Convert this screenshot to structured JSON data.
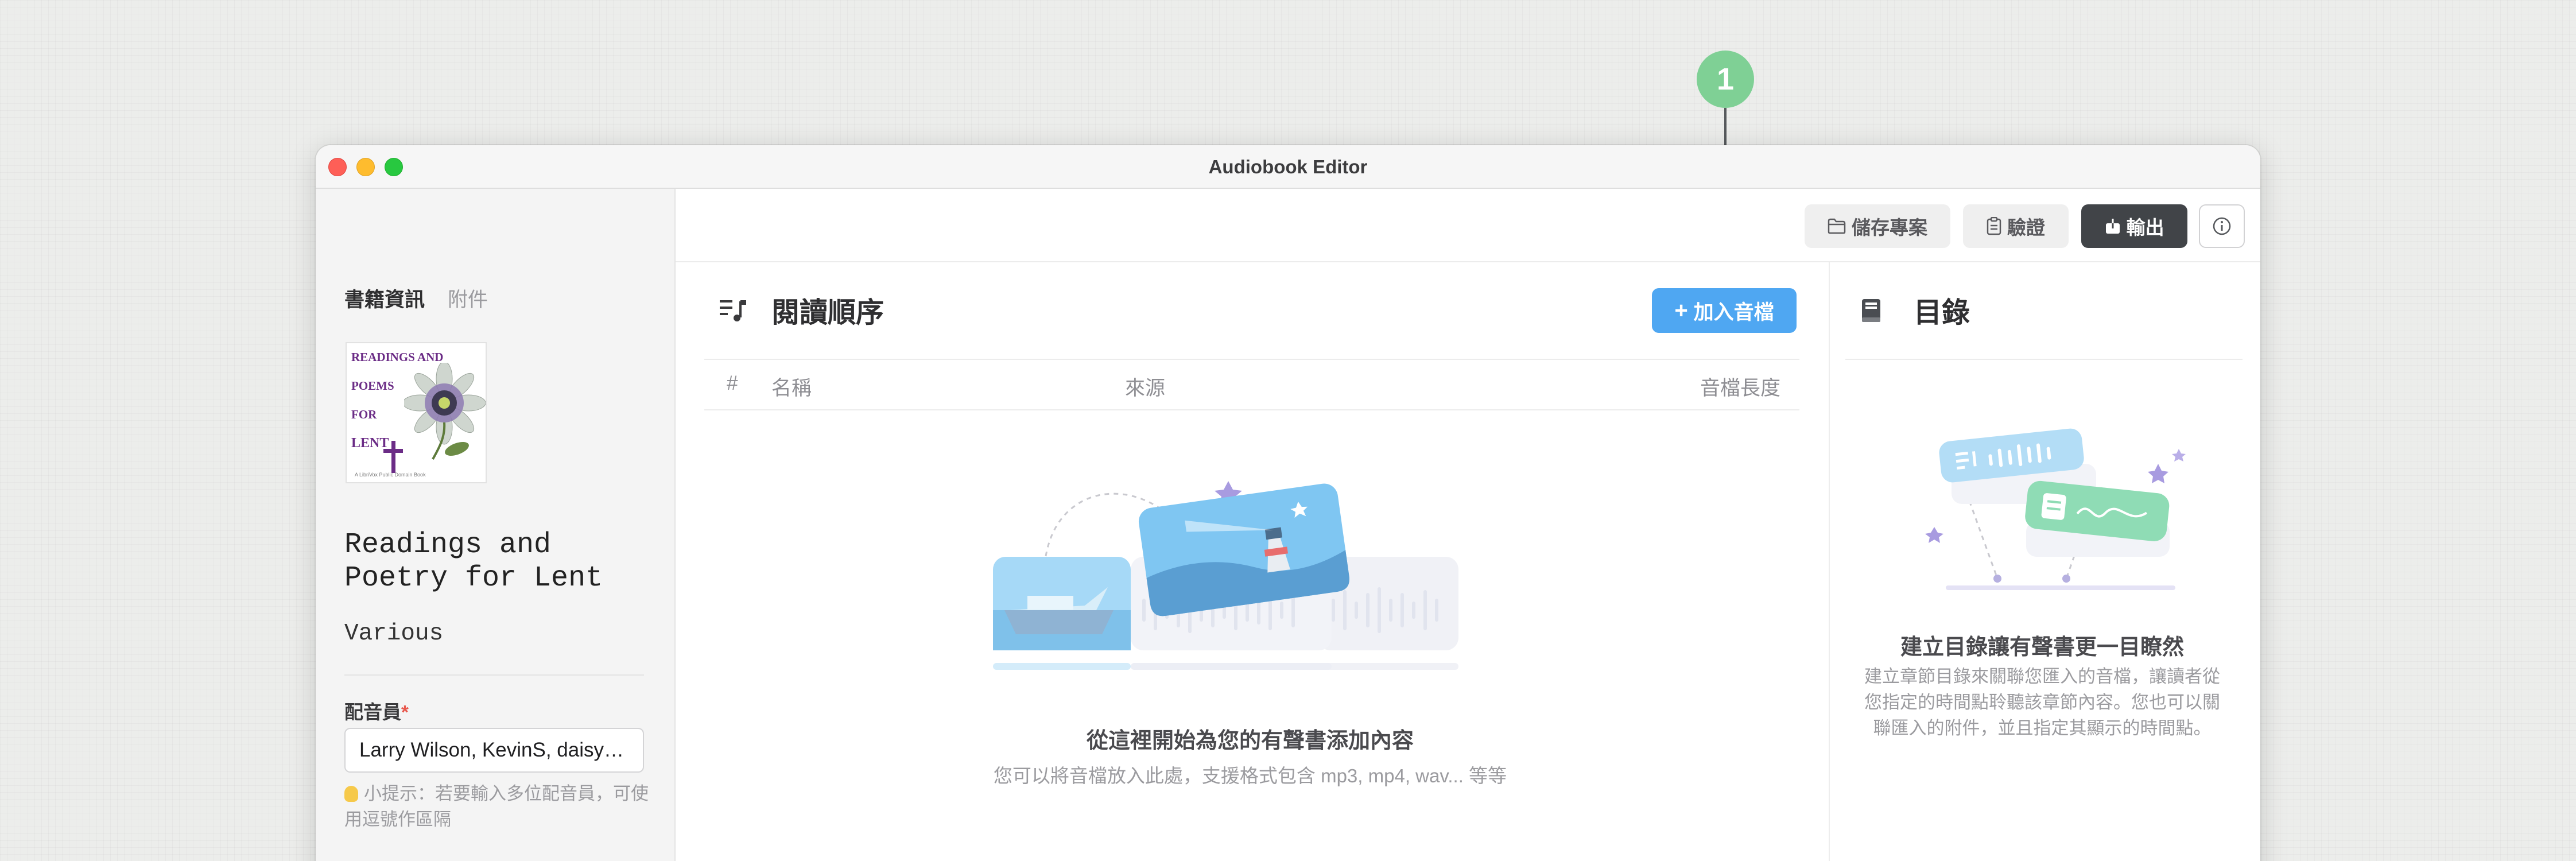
{
  "callout": {
    "step": "1"
  },
  "window": {
    "title": "Audiobook Editor"
  },
  "sidebar": {
    "tabs": {
      "book_info": "書籍資訊",
      "attachments": "附件"
    },
    "cover": {
      "lines": [
        "READINGS AND",
        "POEMS",
        "FOR",
        "LENT"
      ],
      "footer": "A LibriVox Public Domain Book"
    },
    "book_title": "Readings and Poetry for Lent",
    "author": "Various",
    "narrator": {
      "label": "配音員",
      "required_mark": "*",
      "value": "Larry Wilson, KevinS, daisy…"
    },
    "hint": "小提示：若要輸入多位配音員，可使用逗號作區隔"
  },
  "toolbar": {
    "save_label": "儲存專案",
    "validate_label": "驗證",
    "export_label": "輸出",
    "info_icon": "info-icon"
  },
  "reading_order": {
    "title": "閱讀順序",
    "add_button": "加入音檔",
    "columns": {
      "index": "#",
      "name": "名稱",
      "source": "來源",
      "duration": "音檔長度"
    },
    "empty_title": "從這裡開始為您的有聲書添加內容",
    "empty_subtitle": "您可以將音檔放入此處，支援格式包含 mp3, mp4, wav... 等等"
  },
  "toc": {
    "title": "目錄",
    "empty_title": "建立目錄讓有聲書更一目瞭然",
    "empty_desc": "建立章節目錄來關聯您匯入的音檔，讓讀者從您指定的時間點聆聽該章節內容。您也可以關聯匯入的附件，並且指定其顯示的時間點。"
  },
  "colors": {
    "accent_blue": "#4fa7f2",
    "callout_green": "#7fd095",
    "dark_button": "#414448"
  }
}
